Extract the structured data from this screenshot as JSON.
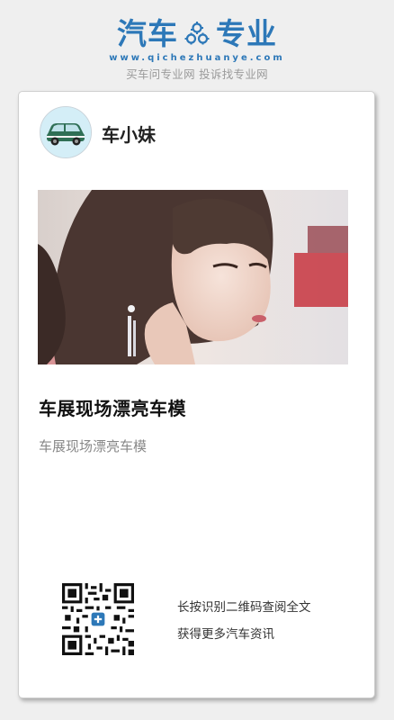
{
  "logo": {
    "left_text": "汽车",
    "right_text": "专业",
    "url": "www.qichezhuanye.com",
    "slogan": "买车问专业网 投诉找专业网",
    "icon": "gears-icon",
    "brand_color": "#2d78b8"
  },
  "card": {
    "author_name": "车小妹",
    "avatar_icon": "car-avatar-icon",
    "image_desc": "hero-photo",
    "title": "车展现场漂亮车模",
    "summary": "车展现场漂亮车模",
    "qr_icon": "qr-code-icon",
    "qr_line1": "长按识别二维码查阅全文",
    "qr_line2": "获得更多汽车资讯"
  }
}
